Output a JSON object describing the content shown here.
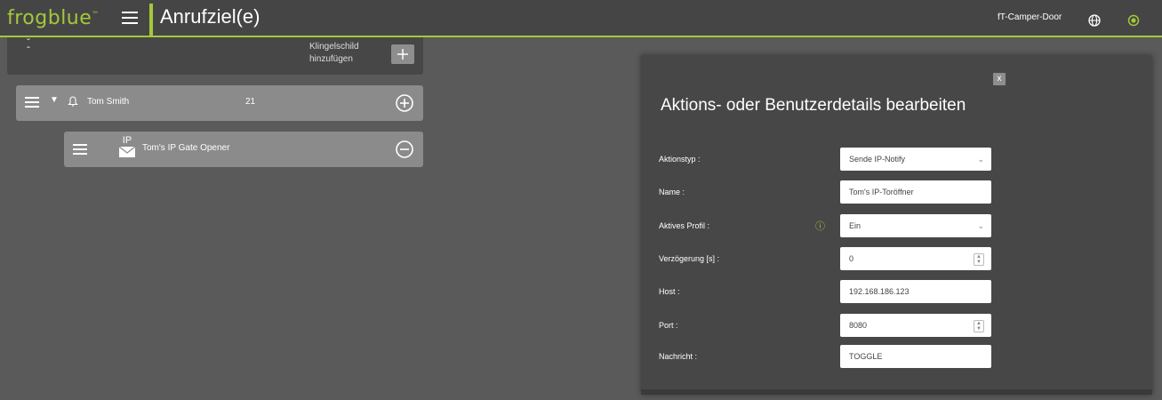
{
  "header": {
    "logo": "frogblue",
    "logo_mark": "™",
    "page_title": "Anrufziel(e)",
    "device_name": "fT-Camper-Door",
    "accent_color": "#a3c93a"
  },
  "icons": [
    "menu-icon",
    "globe-icon",
    "status-icon",
    "chevron-up-down-icon",
    "plus-icon",
    "bell-icon",
    "plus-circle-icon",
    "minus-circle-icon",
    "ip-mail-icon"
  ],
  "sign_bar": {
    "add_label_line1": "Klingelschild",
    "add_label_line2": "hinzufügen"
  },
  "contact": {
    "name": "Tom Smith",
    "number": "21"
  },
  "action": {
    "icon_text": "IP",
    "name": "Tom's IP Gate Opener"
  },
  "dialog": {
    "close_label": "x",
    "title": "Aktions- oder Benutzerdetails bearbeiten",
    "fields": [
      {
        "label": "Aktionstyp :",
        "value": "Sende IP-Notify",
        "type": "select"
      },
      {
        "label": "Name :",
        "value": "Tom's IP-Toröffner",
        "type": "text"
      },
      {
        "label": "Aktives Profil :",
        "value": "Ein",
        "type": "select",
        "info": "ⓘ"
      },
      {
        "label": "Verzögerung [s] :",
        "value": "0",
        "type": "number"
      },
      {
        "label": "Host :",
        "value": "192.168.186.123",
        "type": "text"
      },
      {
        "label": "Port :",
        "value": "8080",
        "type": "number"
      },
      {
        "label": "Nachricht :",
        "value": "TOGGLE",
        "type": "text"
      }
    ]
  }
}
